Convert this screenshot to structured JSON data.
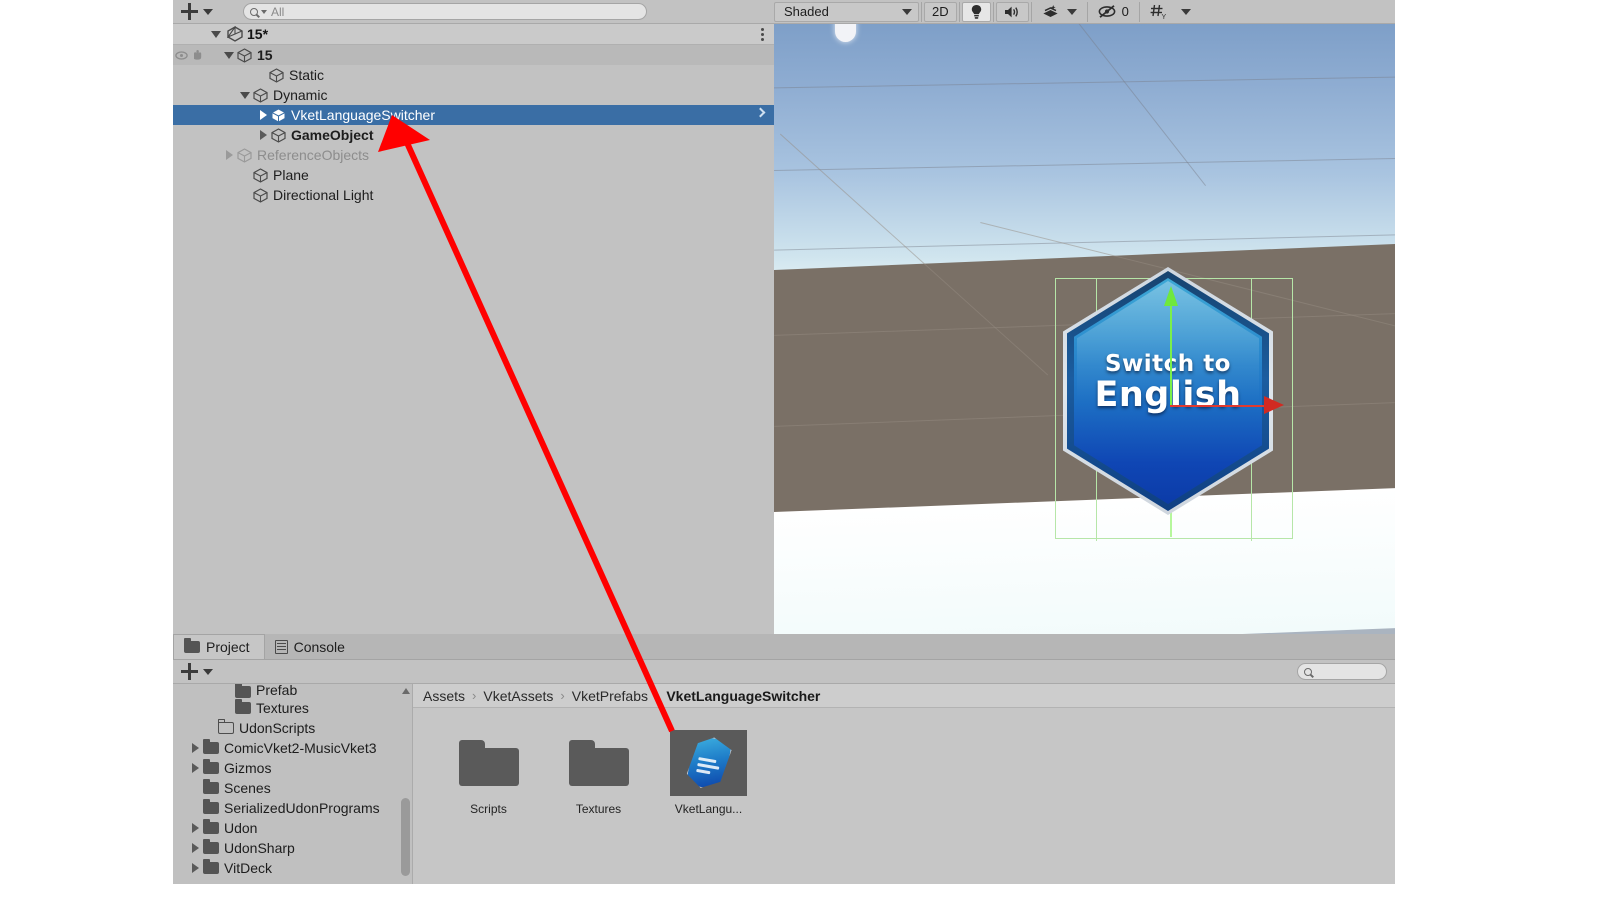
{
  "hierarchy": {
    "add_label": "+",
    "search": {
      "placeholder": "All",
      "value": ""
    },
    "scene_root": {
      "label": "15*",
      "icon": "unity-scene-icon"
    },
    "rows": [
      {
        "label": "15",
        "depth": 1,
        "arrow": "down",
        "icon": "cube-icon",
        "state": "shaded"
      },
      {
        "label": "Static",
        "depth": 2,
        "arrow": "none",
        "icon": "cube-icon",
        "state": "normal"
      },
      {
        "label": "Dynamic",
        "depth": 2,
        "arrow": "down",
        "icon": "cube-icon",
        "state": "normal"
      },
      {
        "label": "VketLanguageSwitcher",
        "depth": 3,
        "arrow": "right",
        "icon": "prefab-cube-icon",
        "state": "selected"
      },
      {
        "label": "GameObject",
        "depth": 3,
        "arrow": "right",
        "icon": "cube-icon",
        "state": "normal"
      },
      {
        "label": "ReferenceObjects",
        "depth": 2,
        "arrow": "right",
        "icon": "cube-icon",
        "state": "dim"
      },
      {
        "label": "Plane",
        "depth": 2,
        "arrow": "none",
        "icon": "cube-icon",
        "state": "normal"
      },
      {
        "label": "Directional Light",
        "depth": 2,
        "arrow": "none",
        "icon": "cube-icon",
        "state": "normal"
      }
    ]
  },
  "scene_view": {
    "draw_mode": "Shaded",
    "toggle_2d": "2D",
    "lighting_icon": "lightbulb-icon",
    "audio_icon": "speaker-icon",
    "effects_icon": "effects-icon",
    "visibility_icon": "hidden-eye-icon",
    "hidden_count": "0",
    "grid_icon": "grid-y-icon",
    "selected_object": {
      "line1": "Switch to",
      "line2": "English"
    },
    "gizmo": {
      "y_axis_color": "#7bf04a",
      "x_axis_color": "#e03a2f",
      "selection_outline_color": "#b6e6a8"
    }
  },
  "dock": {
    "tabs": [
      {
        "label": "Project",
        "icon": "folder-icon",
        "active": true
      },
      {
        "label": "Console",
        "icon": "console-icon",
        "active": false
      }
    ],
    "add_label": "+",
    "search": {
      "placeholder": "",
      "value": ""
    },
    "tree": [
      {
        "label": "Prefab",
        "depth": 3,
        "arrow": "none",
        "icon": "folder-icon"
      },
      {
        "label": "Textures",
        "depth": 3,
        "arrow": "none",
        "icon": "folder-icon"
      },
      {
        "label": "UdonScripts",
        "depth": 2,
        "arrow": "none",
        "icon": "folder-open-icon"
      },
      {
        "label": "ComicVket2-MusicVket3",
        "depth": 1,
        "arrow": "right",
        "icon": "folder-icon"
      },
      {
        "label": "Gizmos",
        "depth": 1,
        "arrow": "right",
        "icon": "folder-icon"
      },
      {
        "label": "Scenes",
        "depth": 1,
        "arrow": "none",
        "icon": "folder-icon"
      },
      {
        "label": "SerializedUdonPrograms",
        "depth": 1,
        "arrow": "none",
        "icon": "folder-icon"
      },
      {
        "label": "Udon",
        "depth": 1,
        "arrow": "right",
        "icon": "folder-icon"
      },
      {
        "label": "UdonSharp",
        "depth": 1,
        "arrow": "right",
        "icon": "folder-icon"
      },
      {
        "label": "VitDeck",
        "depth": 1,
        "arrow": "right",
        "icon": "folder-icon"
      }
    ],
    "breadcrumb": [
      {
        "label": "Assets",
        "current": false
      },
      {
        "label": "VketAssets",
        "current": false
      },
      {
        "label": "VketPrefabs",
        "current": false
      },
      {
        "label": "VketLanguageSwitcher",
        "current": true
      }
    ],
    "breadcrumb_sep": "›",
    "assets": [
      {
        "label": "Scripts",
        "type": "folder",
        "selected": false
      },
      {
        "label": "Textures",
        "type": "folder",
        "selected": false
      },
      {
        "label": "VketLangu...",
        "type": "prefab",
        "selected": true
      }
    ]
  },
  "annotation": {
    "color": "#ff0000",
    "shape": "arrow"
  }
}
